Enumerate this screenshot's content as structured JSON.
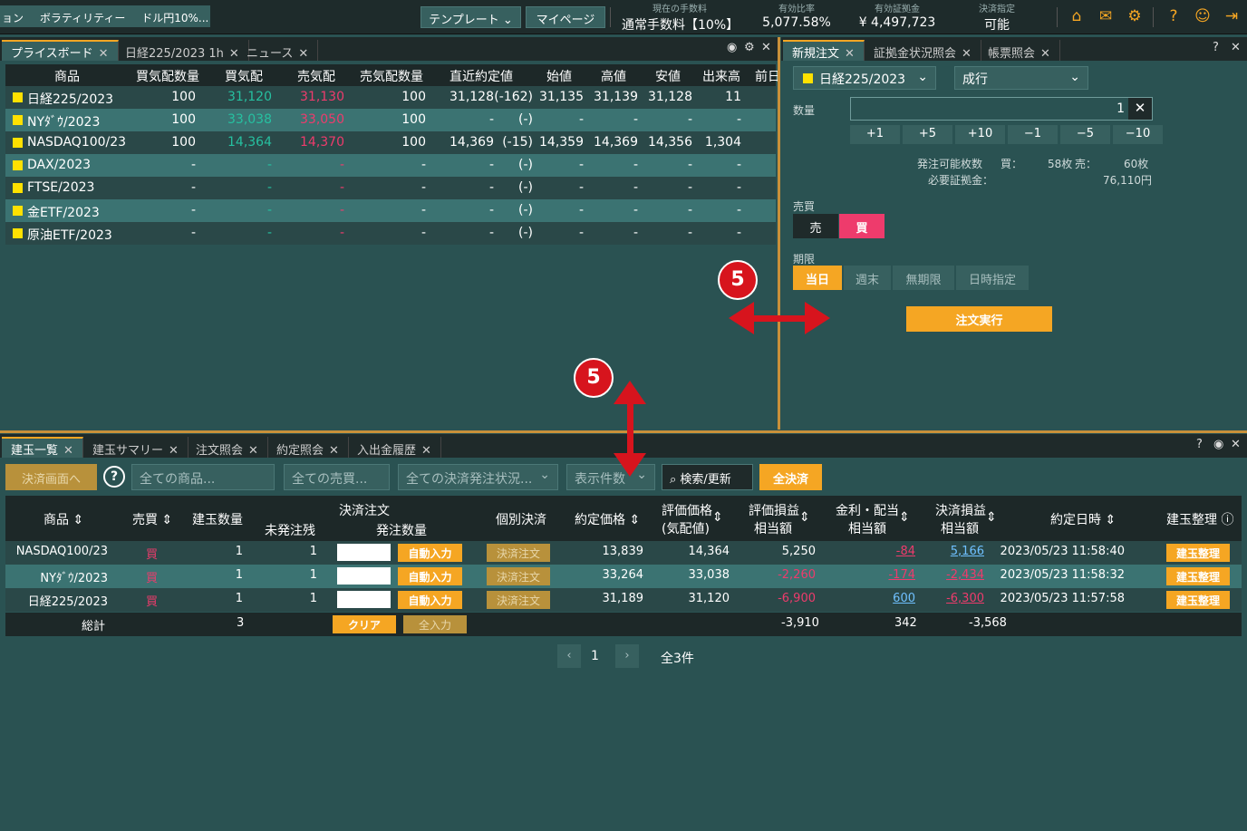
{
  "topbar": {
    "ticker": [
      "ョン",
      "ボラティリティー",
      "ドル円10%..."
    ],
    "template_label": "テンプレート",
    "mypage_label": "マイページ",
    "fee_label": "現在の手数料",
    "fee_value": "通常手数料【10%】",
    "ratio_label": "有効比率",
    "ratio_value": "5,077.58%",
    "margin_label": "有効証拠金",
    "margin_value": "¥ 4,497,723",
    "settle_label": "決済指定",
    "settle_value": "可能"
  },
  "priceboard": {
    "tabs": [
      "プライスボード",
      "日経225/2023 1h",
      "ニュース"
    ],
    "columns": [
      "商品",
      "買気配数量",
      "買気配",
      "売気配",
      "売気配数量",
      "直近約定値",
      "始値",
      "高値",
      "安値",
      "出来高",
      "前日"
    ],
    "rows": [
      {
        "name": "日経225/2023",
        "bidq": "100",
        "bid": "31,120",
        "ask": "31,130",
        "askq": "100",
        "last": "31,128",
        "chg": "(-162)",
        "open": "31,135",
        "high": "31,139",
        "low": "31,128",
        "vol": "11"
      },
      {
        "name": "NYﾀﾞｳ/2023",
        "bidq": "100",
        "bid": "33,038",
        "ask": "33,050",
        "askq": "100",
        "last": "-",
        "chg": "(-)",
        "open": "-",
        "high": "-",
        "low": "-",
        "vol": "-"
      },
      {
        "name": "NASDAQ100/23",
        "bidq": "100",
        "bid": "14,364",
        "ask": "14,370",
        "askq": "100",
        "last": "14,369",
        "chg": "(-15)",
        "open": "14,359",
        "high": "14,369",
        "low": "14,356",
        "vol": "1,304"
      },
      {
        "name": "DAX/2023",
        "bidq": "-",
        "bid": "-",
        "ask": "-",
        "askq": "-",
        "last": "-",
        "chg": "(-)",
        "open": "-",
        "high": "-",
        "low": "-",
        "vol": "-"
      },
      {
        "name": "FTSE/2023",
        "bidq": "-",
        "bid": "-",
        "ask": "-",
        "askq": "-",
        "last": "-",
        "chg": "(-)",
        "open": "-",
        "high": "-",
        "low": "-",
        "vol": "-"
      },
      {
        "name": "金ETF/2023",
        "bidq": "-",
        "bid": "-",
        "ask": "-",
        "askq": "-",
        "last": "-",
        "chg": "(-)",
        "open": "-",
        "high": "-",
        "low": "-",
        "vol": "-"
      },
      {
        "name": "原油ETF/2023",
        "bidq": "-",
        "bid": "-",
        "ask": "-",
        "askq": "-",
        "last": "-",
        "chg": "(-)",
        "open": "-",
        "high": "-",
        "low": "-",
        "vol": "-"
      }
    ]
  },
  "order": {
    "tabs": [
      "新規注文",
      "証拠金状況照会",
      "帳票照会"
    ],
    "product": "日経225/2023",
    "order_type": "成行",
    "qty_label": "数量",
    "qty_value": "1",
    "increments": [
      "+1",
      "+5",
      "+10",
      "−1",
      "−5",
      "−10"
    ],
    "avail_label": "発注可能枚数",
    "buy_label": "買：",
    "buy_value": "58枚",
    "sell_label": "売：",
    "sell_value": "60枚",
    "req_margin_label": "必要証拠金：",
    "req_margin_value": "76,110円",
    "side_label": "売買",
    "sell_btn": "売",
    "buy_btn": "買",
    "period_label": "期限",
    "periods": [
      "当日",
      "週末",
      "無期限",
      "日時指定"
    ],
    "submit_label": "注文実行"
  },
  "positions": {
    "tabs": [
      "建玉一覧",
      "建玉サマリー",
      "注文照会",
      "約定照会",
      "入出金履歴"
    ],
    "settle_screen_btn": "決済画面へ",
    "product_filter": "全ての商品...",
    "side_filter": "全ての売買...",
    "status_filter": "全ての決済発注状況...",
    "count_filter": "表示件数",
    "search_btn": "検索/更新",
    "settle_all_btn": "全決済",
    "headers": {
      "product": "商品",
      "side": "売買",
      "qty": "建玉数量",
      "settle_order": "決済注文",
      "unsent": "未発注残",
      "order_qty": "発注数量",
      "individual": "個別決済",
      "price": "約定価格",
      "eval1": "評価価格",
      "eval2": "(気配値)",
      "pnl1": "評価損益",
      "pnl2": "相当額",
      "div1": "金利・配当",
      "div2": "相当額",
      "spnl1": "決済損益",
      "spnl2": "相当額",
      "datetime": "約定日時",
      "arrange": "建玉整理"
    },
    "rows": [
      {
        "name": "NASDAQ100/23",
        "side": "買",
        "qty": "1",
        "unsent": "1",
        "auto": "自動入力",
        "settle": "決済注文",
        "price": "13,839",
        "eval": "14,364",
        "pnl": "5,250",
        "div": "-84",
        "spnl": "5,166",
        "dt": "2023/05/23 11:58:40",
        "arrange": "建玉整理"
      },
      {
        "name": "NYﾀﾞｳ/2023",
        "side": "買",
        "qty": "1",
        "unsent": "1",
        "auto": "自動入力",
        "settle": "決済注文",
        "price": "33,264",
        "eval": "33,038",
        "pnl": "-2,260",
        "div": "-174",
        "spnl": "-2,434",
        "dt": "2023/05/23 11:58:32",
        "arrange": "建玉整理"
      },
      {
        "name": "日経225/2023",
        "side": "買",
        "qty": "1",
        "unsent": "1",
        "auto": "自動入力",
        "settle": "決済注文",
        "price": "31,189",
        "eval": "31,120",
        "pnl": "-6,900",
        "div": "600",
        "spnl": "-6,300",
        "dt": "2023/05/23 11:57:58",
        "arrange": "建玉整理"
      }
    ],
    "total": {
      "label": "総計",
      "qty": "3",
      "clear": "クリア",
      "allin": "全入力",
      "pnl": "-3,910",
      "div": "342",
      "spnl": "-3,568"
    },
    "page": "1",
    "page_total": "全3件"
  },
  "annotations": {
    "badge1": "5",
    "badge2": "5"
  },
  "colors": {
    "accent": "#f5a623",
    "bid": "#26c0a0",
    "ask": "#ee3b6c",
    "panel": "#2a5252",
    "arrow": "#d7141d"
  }
}
